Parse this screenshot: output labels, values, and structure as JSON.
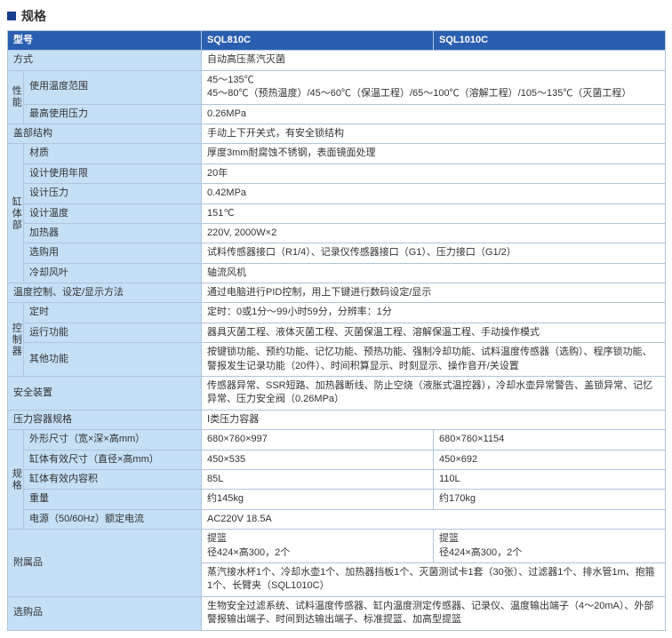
{
  "title": "规格",
  "header": {
    "model": "型号",
    "c1": "SQL810C",
    "c2": "SQL1010C"
  },
  "rows": {
    "method_label": "方式",
    "method_val": "自动高压蒸汽灭菌",
    "perf_group": "性能",
    "temp_range_label": "使用温度范围",
    "temp_range_val1": "45～135℃",
    "temp_range_val2": "45～80℃（预热温度）/45～60℃（保温工程）/65～100℃（溶解工程）/105～135℃（灭菌工程）",
    "max_press_label": "最高使用压力",
    "max_press_val": "0.26MPa",
    "lid_label": "盖部结构",
    "lid_val": "手动上下开关式，有安全锁结构",
    "tank_group": "缸体部",
    "material_label": "材质",
    "material_val": "厚度3mm耐腐蚀不锈钢，表面镜面处理",
    "life_label": "设计使用年限",
    "life_val": "20年",
    "design_press_label": "设计压力",
    "design_press_val": "0.42MPa",
    "design_temp_label": "设计温度",
    "design_temp_val": "151℃",
    "heater_label": "加热器",
    "heater_val": "220V, 2000W×2",
    "option_label": "选购用",
    "option_val": "试料传感器接口（R1/4）、记录仪传感器接口（G1）、压力接口（G1/2）",
    "fan_label": "冷却风叶",
    "fan_val": "轴流风机",
    "ctrl_method_label": "温度控制、设定/显示方法",
    "ctrl_method_val": "通过电脑进行PID控制，用上下键进行数码设定/显示",
    "ctrl_group": "控制器",
    "timer_label": "定时",
    "timer_val": "定时：0或1分～99小时59分，分辨率：1分",
    "run_label": "运行功能",
    "run_val": "器具灭菌工程、液体灭菌工程、灭菌保温工程、溶解保温工程、手动操作模式",
    "other_label": "其他功能",
    "other_val": "按键锁功能、预约功能、记忆功能、预热功能、强制冷却功能、试料温度传感器（选购）、程序锁功能、警报发生记录功能（20件）、时间积算显示、时刻显示、操作音开/关设置",
    "safety_label": "安全装置",
    "safety_val": "传感器异常、SSR短路、加热器断线、防止空烧（液胀式温控器），冷却水壶异常警告、盖锁异常、记忆异常、压力安全阀（0.26MPa）",
    "vessel_label": "压力容器规格",
    "vessel_val": "Ⅰ类压力容器",
    "spec_group": "规格",
    "outer_label": "外形尺寸（宽×深×高mm）",
    "outer_c1": "680×760×997",
    "outer_c2": "680×760×1154",
    "inner_label": "缸体有效尺寸（直径×高mm）",
    "inner_c1": "450×535",
    "inner_c2": "450×692",
    "volume_label": "缸体有效内容积",
    "volume_c1": "85L",
    "volume_c2": "110L",
    "weight_label": "重量",
    "weight_c1": "约145kg",
    "weight_c2": "约170kg",
    "power_label": "电源（50/60Hz）额定电流",
    "power_val": "AC220V 18.5A",
    "acc_label": "附属品",
    "acc_c1a": "提篮",
    "acc_c1b": "径424×高300，2个",
    "acc_c2a": "提篮",
    "acc_c2b": "径424×高300，2个",
    "acc_full": "蒸汽接水杯1个、冷却水壶1个、加热器挡板1个、灭菌测试卡1套（30张）、过滤器1个、排水管1m、抱箍1个、长臂夹（SQL1010C）",
    "optional_label": "选购品",
    "optional_val": "生物安全过滤系统、试料温度传感器、缸内温度测定传感器、记录仪、温度输出端子（4～20mA）、外部警报输出端子、时间到达输出端子、标准提篮、加高型提篮"
  }
}
